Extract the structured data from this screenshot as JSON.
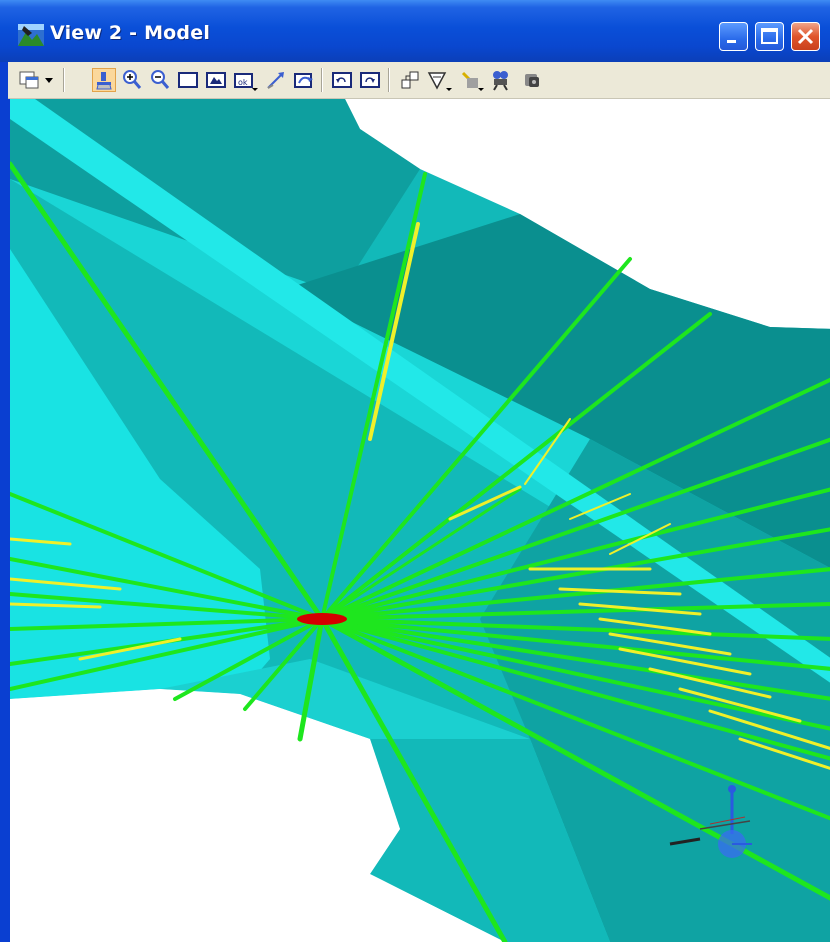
{
  "window": {
    "title": "View 2 - Model",
    "controls": [
      "minimize",
      "maximize",
      "close"
    ]
  },
  "toolbar": {
    "tools": [
      "view-attributes-icon",
      "dropdown-arrow-icon",
      "update-view-icon",
      "zoom-in-icon",
      "zoom-out-icon",
      "window-area-icon",
      "fit-view-icon",
      "rotate-view-icon",
      "pan-view-icon",
      "view-previous-icon",
      "view-next-icon",
      "copy-view-icon",
      "view-display-mode-icon",
      "clip-volume-icon",
      "camera-icon",
      "render-icon",
      "view-lighting-icon"
    ],
    "active_tool": "update-view-icon"
  },
  "colors": {
    "titlebar": "#0a4fd8",
    "surface_light": "#19e3e3",
    "surface_mid": "#12b9b9",
    "surface_dark": "#0a8f8f",
    "ray_green": "#1ee61e",
    "ray_yellow": "#f0f02a",
    "target_red": "#d40000",
    "gizmo_blue": "#2a5ae0"
  }
}
